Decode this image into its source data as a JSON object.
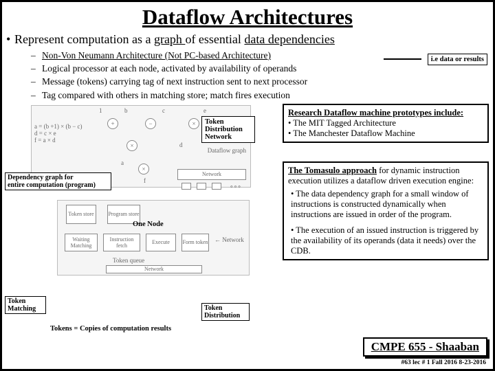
{
  "title": "Dataflow Architectures",
  "bullet1_pre": "Represent computation as a ",
  "bullet1_graph": "graph ",
  "bullet1_mid": "of essential ",
  "bullet1_dep": "data dependencies",
  "sub": [
    "Non-Von Neumann Architecture (Not PC-based Architecture)",
    "Logical processor at each node, activated by availability of operands",
    "Message (tokens) carrying tag of next instruction sent to next processor",
    "Tag compared with others in matching store; match fires execution"
  ],
  "note_ie": "i.e data or results",
  "eqs": {
    "l1": "a = (b +1) × (b − c)",
    "l2": "d = c × e",
    "l3": "f = a × d"
  },
  "tdn_label": "Token\nDistribution\nNetwork",
  "depgraph_label": "Dependency graph for\nentire computation (program)",
  "one_node": "One Node",
  "token_matching": "Token\nMatching",
  "tokens_copies": "Tokens = Copies of computation results",
  "token_distribution": "Token\nDistribution",
  "research": {
    "h": "Research  Dataflow machine prototypes include:",
    "i1": "• The MIT Tagged Architecture",
    "i2": "• The Manchester Dataflow Machine"
  },
  "tomasulo": {
    "p1a": "The Tomasulo approach",
    "p1b": " for dynamic instruction execution utilizes a dataflow driven execution engine:",
    "p2": "• The data dependency graph  for a small window of instructions is constructed dynamically when instructions are issued in order of the program.",
    "p3": "• The execution of an issued instruction is triggered by the availability of its operands (data it needs) over the CDB."
  },
  "course": "CMPE 655 - Shaaban",
  "footer_meta": "#63  lec # 1   Fall 2016   8-23-2016",
  "dg": {
    "top": {
      "b1": "1",
      "b2": "b",
      "c": "c",
      "e": "e",
      "a": "a",
      "d": "d",
      "f": "f"
    },
    "dflabel": "Dataflow graph",
    "net": "Network",
    "nodes": [
      "Token store",
      "Program store",
      "Waiting Matching",
      "Instruction fetch",
      "Execute",
      "Form token",
      "Network"
    ],
    "tq": "Token queue"
  }
}
